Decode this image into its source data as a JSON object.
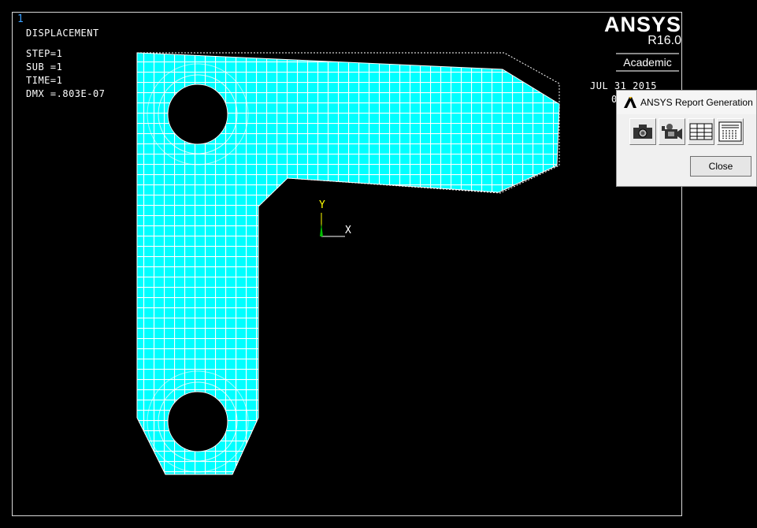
{
  "window_number": "1",
  "plot_info": {
    "title": "DISPLACEMENT",
    "step": "STEP=1",
    "sub": "SUB =1",
    "time": "TIME=1",
    "dmx": "DMX =.803E-07"
  },
  "branding": {
    "product": "ANSYS",
    "version": "R16.0",
    "license": "Academic"
  },
  "date": "JUL 31 2015",
  "time_partial": "0",
  "triad": {
    "x_label": "X",
    "y_label": "Y"
  },
  "colors": {
    "mesh_fill": "#00ffff",
    "mesh_lines": "#ffffff",
    "background": "#000000"
  },
  "dialog": {
    "title": "ANSYS Report Generation",
    "tools": [
      "camera-icon",
      "video-camera-icon",
      "table-icon",
      "listing-icon"
    ],
    "close_label": "Close"
  }
}
